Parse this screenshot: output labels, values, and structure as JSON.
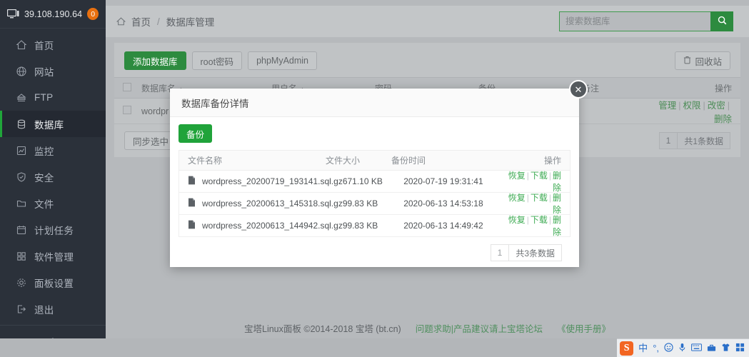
{
  "sidebar": {
    "ip": "39.108.190.64",
    "badge": "0",
    "monitor_icon": "monitor-icon",
    "add_label": "+",
    "items": [
      {
        "label": "首页",
        "icon": "home-icon",
        "active": false
      },
      {
        "label": "网站",
        "icon": "globe-icon",
        "active": false
      },
      {
        "label": "FTP",
        "icon": "server-icon",
        "active": false
      },
      {
        "label": "数据库",
        "icon": "database-icon",
        "active": true
      },
      {
        "label": "监控",
        "icon": "chart-icon",
        "active": false
      },
      {
        "label": "安全",
        "icon": "shield-icon",
        "active": false
      },
      {
        "label": "文件",
        "icon": "folder-icon",
        "active": false
      },
      {
        "label": "计划任务",
        "icon": "calendar-icon",
        "active": false
      },
      {
        "label": "软件管理",
        "icon": "grid-icon",
        "active": false
      },
      {
        "label": "面板设置",
        "icon": "gear-icon",
        "active": false
      },
      {
        "label": "退出",
        "icon": "logout-icon",
        "active": false
      }
    ]
  },
  "header": {
    "home_icon": "home-icon",
    "crumb_home": "首页",
    "crumb_sep": "/",
    "crumb_current": "数据库管理",
    "search_placeholder": "搜索数据库",
    "search_value": "",
    "search_icon": "search-icon"
  },
  "toolbar": {
    "add_db": "添加数据库",
    "root_pass": "root密码",
    "phpmyadmin": "phpMyAdmin",
    "recycle": "回收站",
    "recycle_icon": "trash-icon",
    "sync_selected": "同步选中"
  },
  "table": {
    "headers": [
      "数据库名",
      "用户名",
      "密码",
      "备份",
      "备注",
      "操作"
    ],
    "sort_icon": "▲",
    "rows": [
      {
        "name": "wordpr",
        "user": "",
        "password": "",
        "backup": "",
        "note": "",
        "ops": [
          "管理",
          "权限",
          "改密",
          "删除"
        ]
      }
    ],
    "pager": {
      "page": "1",
      "total": "共1条数据"
    }
  },
  "modal": {
    "title": "数据库备份详情",
    "close_icon": "close-icon",
    "backup_button": "备份",
    "headers": [
      "文件名称",
      "文件大小",
      "备份时间",
      "操作"
    ],
    "file_icon": "file-icon",
    "rows": [
      {
        "file": "wordpress_20200719_193141.sql.gz",
        "size": "671.10 KB",
        "time": "2020-07-19 19:31:41",
        "ops": [
          "恢复",
          "下载",
          "删除"
        ]
      },
      {
        "file": "wordpress_20200613_145318.sql.gz",
        "size": "99.83 KB",
        "time": "2020-06-13 14:53:18",
        "ops": [
          "恢复",
          "下载",
          "删除"
        ]
      },
      {
        "file": "wordpress_20200613_144942.sql.gz",
        "size": "99.83 KB",
        "time": "2020-06-13 14:49:42",
        "ops": [
          "恢复",
          "下载",
          "删除"
        ]
      }
    ],
    "pager": {
      "page": "1",
      "total": "共3条数据"
    }
  },
  "footer": {
    "copyright": "宝塔Linux面板 ©2014-2018 宝塔 (bt.cn)",
    "forum_link": "问题求助|产品建议请上宝塔论坛",
    "manual_link": "《使用手册》"
  },
  "ime": {
    "logo": "S",
    "mode": "中",
    "punct": "°,",
    "items": [
      "smiley-icon",
      "microphone-icon",
      "keyboard-icon",
      "toolbox-icon",
      "skin-icon",
      "apps-icon"
    ]
  },
  "colors": {
    "accent_green": "#20a33a",
    "sidebar_bg": "#2b313a",
    "badge_orange": "#e8700f"
  }
}
